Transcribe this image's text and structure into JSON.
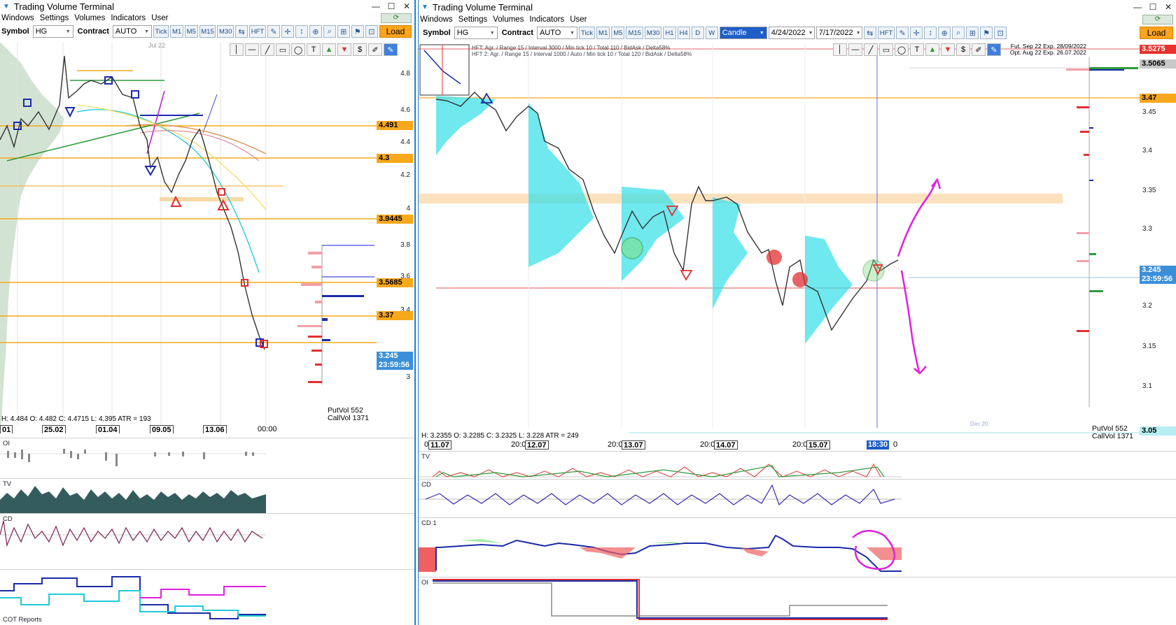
{
  "left": {
    "title": "Trading Volume Terminal",
    "menu": [
      "Windows",
      "Settings",
      "Volumes",
      "Indicators",
      "User"
    ],
    "toolbar": {
      "symbol_label": "Symbol",
      "symbol_value": "HG",
      "contract_label": "Contract",
      "contract_value": "AUTO",
      "timeframes": [
        "Tick",
        "M1",
        "M5",
        "M15",
        "M30"
      ],
      "hft_label": "HFT",
      "load_label": "Load"
    },
    "price_ticks": [
      "4.8",
      "4.6",
      "4.4",
      "4.2",
      "4",
      "3.8",
      "3.6",
      "3.4",
      "3"
    ],
    "price_levels": [
      "4.491",
      "4.3",
      "3.9445",
      "3.5685",
      "3.37"
    ],
    "current_price": "3.245",
    "countdown": "23:59:56",
    "ohlc": "H: 4.484  O: 4.482  C: 4.4715  L: 4.395  ATR = 193",
    "time_labels": [
      "01",
      "25.02",
      "01.04",
      "09.05",
      "13.06",
      "00:00"
    ],
    "header_date": "Jul 22",
    "put_vol": "PutVol  552",
    "call_vol": "CallVol  1371",
    "panels": [
      "OI",
      "TV",
      "CD",
      "COT Reports"
    ]
  },
  "right": {
    "title": "Trading Volume Terminal",
    "menu": [
      "Windows",
      "Settings",
      "Volumes",
      "Indicators",
      "User"
    ],
    "toolbar": {
      "symbol_label": "Symbol",
      "symbol_value": "HG",
      "contract_label": "Contract",
      "contract_value": "AUTO",
      "timeframes": [
        "Tick",
        "M1",
        "M5",
        "M15",
        "M30",
        "H1",
        "H4",
        "D",
        "W"
      ],
      "chart_type": "Candle",
      "date_from": "4/24/2022",
      "date_to": "7/17/2022",
      "hft_label": "HFT",
      "load_label": "Load"
    },
    "hft_legend": [
      "HFT: Agr. / Range 15 / Interval 3000 / Min tick 10 / Total 110 / BidAsk / Delta58%",
      "HFT 2: Agr. / Range 15 / Interval 1000 / Auto / Min tick 10 / Total 120 / BidAsk / Delta58%"
    ],
    "fut_info": [
      "Fut. Sep 22 Exp. 28/09/2022",
      "Opt. Aug 22 Exp. 26.07.2022"
    ],
    "price_ticks": [
      "3.45",
      "3.4",
      "3.35",
      "3.3",
      "3.2",
      "3.15",
      "3.1"
    ],
    "price_levels": {
      "top_red": "3.5275",
      "gray": "3.5065",
      "orange": "3.47",
      "bottom": "3.05"
    },
    "current_price": "3.245",
    "countdown": "23:59:56",
    "ohlc": "H: 3.2355  O: 3.2285  C: 3.2325  L: 3.228  ATR = 249",
    "time_labels": [
      "0",
      "11.07",
      "20:0",
      "12.07",
      "20:0",
      "13.07",
      "20:0",
      "14.07",
      "20:0",
      "15.07",
      "18:30",
      "0"
    ],
    "dec_label": "Dec 20",
    "put_vol": "PutVol  552",
    "call_vol": "CallVol  1371",
    "panels": [
      "TV",
      "CD",
      "CD 1",
      "OI"
    ]
  },
  "colors": {
    "accent_blue": "#1c7fd6",
    "orange_level": "#f7a81b",
    "load_button": "#ffa41c",
    "bull": "#2e8b57",
    "bear": "#e03030",
    "cyan_profile": "#3fe0e8",
    "magenta_annotation": "#e020e0",
    "left_volume_profile": "#c8dcc8"
  }
}
